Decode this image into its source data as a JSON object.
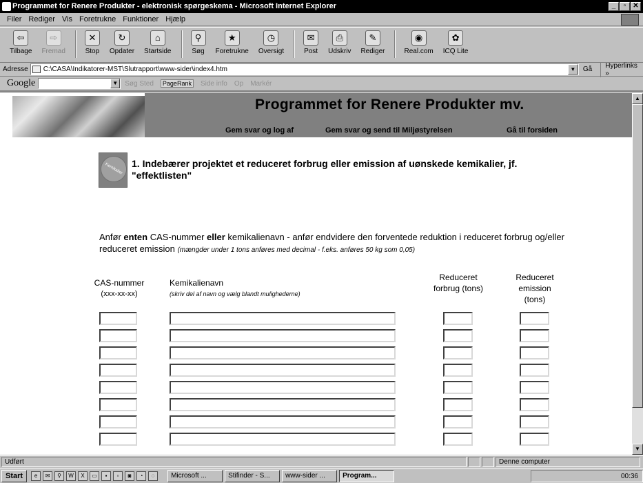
{
  "window": {
    "title": "Programmet for Renere Produkter - elektronisk spørgeskema - Microsoft Internet Explorer",
    "min": "_",
    "max": "▫",
    "close": "✕"
  },
  "menu": [
    "Filer",
    "Rediger",
    "Vis",
    "Foretrukne",
    "Funktioner",
    "Hjælp"
  ],
  "toolbar": [
    {
      "label": "Tilbage",
      "icon": "back-icon",
      "glyph": "⇦",
      "disabled": false
    },
    {
      "label": "Fremad",
      "icon": "forward-icon",
      "glyph": "⇨",
      "disabled": true
    },
    {
      "label": "Stop",
      "icon": "stop-icon",
      "glyph": "✕",
      "disabled": false
    },
    {
      "label": "Opdater",
      "icon": "refresh-icon",
      "glyph": "↻",
      "disabled": false
    },
    {
      "label": "Startside",
      "icon": "home-icon",
      "glyph": "⌂",
      "disabled": false
    },
    {
      "label": "Søg",
      "icon": "search-icon",
      "glyph": "⚲",
      "disabled": false
    },
    {
      "label": "Foretrukne",
      "icon": "favorites-icon",
      "glyph": "★",
      "disabled": false
    },
    {
      "label": "Oversigt",
      "icon": "history-icon",
      "glyph": "◷",
      "disabled": false
    },
    {
      "label": "Post",
      "icon": "mail-icon",
      "glyph": "✉",
      "disabled": false
    },
    {
      "label": "Udskriv",
      "icon": "print-icon",
      "glyph": "⎙",
      "disabled": false
    },
    {
      "label": "Rediger",
      "icon": "edit-icon",
      "glyph": "✎",
      "disabled": false
    },
    {
      "label": "Real.com",
      "icon": "realcom-icon",
      "glyph": "◉",
      "disabled": false
    },
    {
      "label": "ICQ Lite",
      "icon": "icq-icon",
      "glyph": "✿",
      "disabled": false
    }
  ],
  "address": {
    "label": "Adresse",
    "value": "C:\\CASA\\Indikatorer-MST\\Slutrapport\\www-sider\\index4.htm",
    "go": "Gå",
    "links": "Hyperlinks »"
  },
  "google": {
    "logo": "Google",
    "items": [
      "Søg Sted",
      "PageRank",
      "Side info",
      "Op",
      "Markér"
    ]
  },
  "banner": {
    "title": "Programmet for Renere Produkter mv.",
    "links": [
      "Gem svar og log af",
      "Gem svar og send til Miljøstyrelsen",
      "Gå til forsiden"
    ]
  },
  "question": {
    "icon_label": "Kemikalier",
    "text": "1. Indebærer projektet et reduceret forbrug eller emission af uønskede kemikalier, jf. \"effektlisten\""
  },
  "instructions": {
    "p1": "Anfør ",
    "b1": "enten",
    "p2": " CAS-nummer ",
    "b2": "eller",
    "p3": " kemikalienavn - anfør endvidere den forventede reduktion i reduceret forbrug og/eller reduceret emission ",
    "note": "(mængder under 1 tons anføres med decimal - f.eks. anføres 50 kg som 0,05)"
  },
  "table": {
    "cas_header": "CAS-nummer",
    "cas_sub": "(xxx-xx-xx)",
    "name_header": "Kemikalienavn",
    "name_sub": "(skriv del af navn og vælg blandt mulighederne)",
    "forbrug_header": "Reduceret forbrug (tons)",
    "emission_header": "Reduceret emission (tons)",
    "rows": 8
  },
  "status": {
    "text": "Udført",
    "zone": "Denne computer"
  },
  "taskbar": {
    "start": "Start",
    "tasks": [
      "Microsoft ...",
      "Stifinder - S...",
      "www-sider ...",
      "Program..."
    ],
    "clock": "00:36"
  }
}
